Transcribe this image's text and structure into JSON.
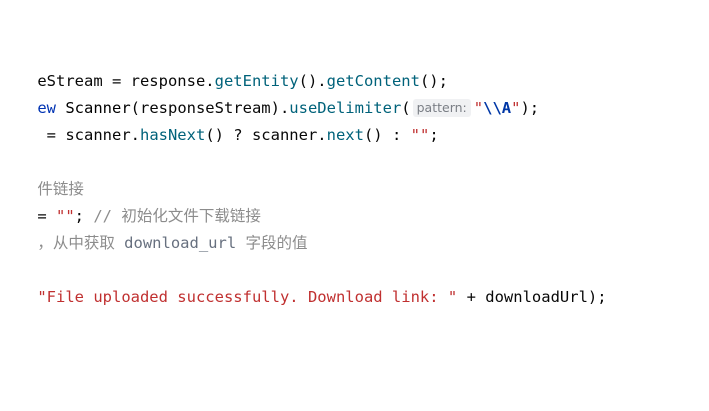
{
  "editor": {
    "lines": [
      {
        "segments": [
          {
            "text": "eStream = response.",
            "kind": "plain"
          },
          {
            "text": "getEntity",
            "kind": "method"
          },
          {
            "text": "().",
            "kind": "plain"
          },
          {
            "text": "getContent",
            "kind": "method"
          },
          {
            "text": "();",
            "kind": "plain"
          }
        ]
      },
      {
        "segments": [
          {
            "text": "ew ",
            "kind": "keyword"
          },
          {
            "text": "Scanner",
            "kind": "class"
          },
          {
            "text": "(responseStream).",
            "kind": "plain"
          },
          {
            "text": "useDelimiter",
            "kind": "method"
          },
          {
            "text": "(",
            "kind": "plain"
          },
          {
            "text": "pattern:",
            "kind": "hint"
          },
          {
            "text": "\"",
            "kind": "string"
          },
          {
            "text": "\\\\A",
            "kind": "escape"
          },
          {
            "text": "\"",
            "kind": "string"
          },
          {
            "text": ");",
            "kind": "plain"
          }
        ]
      },
      {
        "segments": [
          {
            "text": " = scanner.",
            "kind": "plain"
          },
          {
            "text": "hasNext",
            "kind": "method"
          },
          {
            "text": "() ? scanner.",
            "kind": "plain"
          },
          {
            "text": "next",
            "kind": "method"
          },
          {
            "text": "() : ",
            "kind": "plain"
          },
          {
            "text": "\"\"",
            "kind": "string"
          },
          {
            "text": ";",
            "kind": "plain"
          }
        ]
      },
      {
        "segments": [
          {
            "text": "件链接",
            "kind": "comment"
          }
        ]
      },
      {
        "segments": [
          {
            "text": "= ",
            "kind": "plain"
          },
          {
            "text": "\"\"",
            "kind": "string"
          },
          {
            "text": "; ",
            "kind": "plain"
          },
          {
            "text": "// 初始化文件下载链接",
            "kind": "comment"
          }
        ]
      },
      {
        "segments": [
          {
            "text": "，从中获取 ",
            "kind": "comment"
          },
          {
            "text": "download_url",
            "kind": "comment-code"
          },
          {
            "text": " 字段的值",
            "kind": "comment"
          }
        ]
      },
      {
        "segments": [
          {
            "text": "\"File uploaded successfully. Download link: \"",
            "kind": "string"
          },
          {
            "text": " + downloadUrl);",
            "kind": "plain"
          }
        ]
      }
    ]
  },
  "colors": {
    "background": "#ffffff",
    "text": "#080808",
    "method": "#00627a",
    "keyword": "#0033b3",
    "string": "#c03030",
    "escape": "#0037a6",
    "comment": "#8c8c8c",
    "hint_bg": "#f0f1f3"
  }
}
